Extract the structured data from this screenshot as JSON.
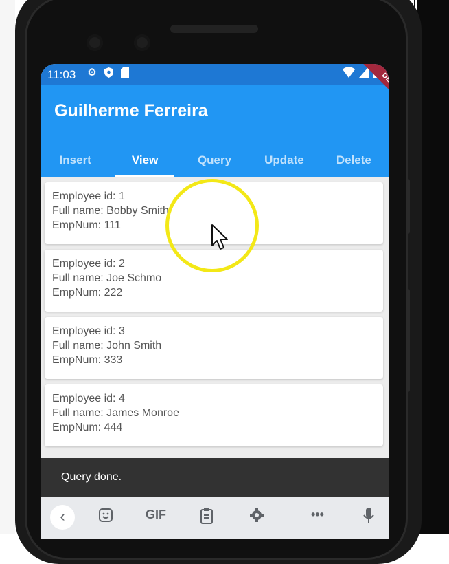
{
  "status_bar": {
    "time": "11:03",
    "left_icons": [
      "gear-icon",
      "shield-icon",
      "sd-card-icon"
    ],
    "right_icons": [
      "wifi-icon",
      "signal-icon",
      "battery-icon"
    ]
  },
  "debug_banner": "DEBUG",
  "app_bar": {
    "title": "Guilherme Ferreira",
    "color": "#2196f3"
  },
  "tabs": [
    {
      "label": "Insert",
      "active": false
    },
    {
      "label": "View",
      "active": true
    },
    {
      "label": "Query",
      "active": false
    },
    {
      "label": "Update",
      "active": false
    },
    {
      "label": "Delete",
      "active": false
    }
  ],
  "employees": [
    {
      "id_line": "Employee id: 1",
      "name_line": "Full name: Bobby Smith",
      "num_line": "EmpNum: 111"
    },
    {
      "id_line": "Employee id: 2",
      "name_line": "Full name: Joe Schmo",
      "num_line": "EmpNum: 222"
    },
    {
      "id_line": "Employee id: 3",
      "name_line": "Full name: John Smith",
      "num_line": "EmpNum: 333"
    },
    {
      "id_line": "Employee id: 4",
      "name_line": "Full name: James Monroe",
      "num_line": "EmpNum: 444"
    }
  ],
  "snackbar": {
    "message": "Query done."
  },
  "keyboard_toolbar": {
    "items": [
      "back-icon",
      "sticker-icon",
      "GIF",
      "clipboard-icon",
      "settings-icon",
      "more-icon",
      "mic-icon"
    ],
    "gif_label": "GIF",
    "more_label": "•••"
  }
}
